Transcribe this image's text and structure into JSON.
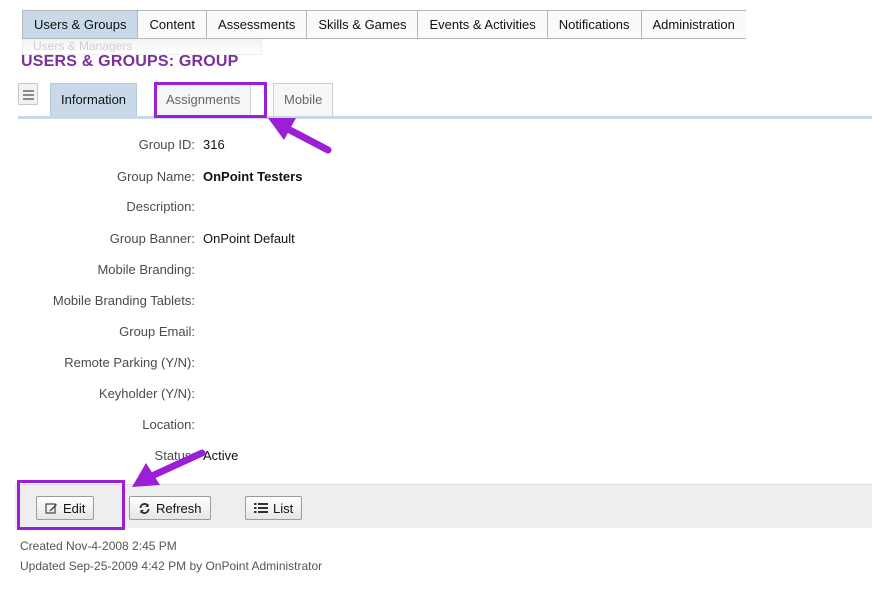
{
  "topnav": {
    "items": [
      {
        "label": "Users & Groups"
      },
      {
        "label": "Content"
      },
      {
        "label": "Assessments"
      },
      {
        "label": "Skills & Games"
      },
      {
        "label": "Events & Activities"
      },
      {
        "label": "Notifications"
      },
      {
        "label": "Administration"
      }
    ],
    "active_index": 0
  },
  "ghost_breadcrumb": "Users & Managers",
  "page_title": "USERS & GROUPS: GROUP",
  "subtabs": {
    "items": [
      {
        "label": "Information"
      },
      {
        "label": "Assignments"
      },
      {
        "label": "Mobile"
      }
    ],
    "active_index": 0
  },
  "details": {
    "group_id": {
      "label": "Group ID:",
      "value": "316"
    },
    "group_name": {
      "label": "Group Name:",
      "value": "OnPoint Testers"
    },
    "description": {
      "label": "Description:",
      "value": ""
    },
    "group_banner": {
      "label": "Group Banner:",
      "value": "OnPoint Default"
    },
    "mobile_branding": {
      "label": "Mobile Branding:",
      "value": ""
    },
    "mobile_branding_tablets": {
      "label": "Mobile Branding Tablets:",
      "value": ""
    },
    "group_email": {
      "label": "Group Email:",
      "value": ""
    },
    "remote_parking": {
      "label": "Remote Parking (Y/N):",
      "value": ""
    },
    "keyholder": {
      "label": "Keyholder (Y/N):",
      "value": ""
    },
    "location": {
      "label": "Location:",
      "value": ""
    },
    "status": {
      "label": "Status:",
      "value": "Active"
    }
  },
  "actions": {
    "edit_label": "Edit",
    "refresh_label": "Refresh",
    "list_label": "List"
  },
  "meta": {
    "created": "Created Nov-4-2008 2:45 PM",
    "updated": "Updated Sep-25-2009 4:42 PM by OnPoint Administrator"
  },
  "colors": {
    "title": "#7a2f9a",
    "highlight": "#9b1fd6",
    "tab_active": "#c9d9e9"
  },
  "icons": [
    "hamburger-menu-icon",
    "edit-icon",
    "refresh-icon",
    "list-icon",
    "arrow-annotation-icon"
  ]
}
